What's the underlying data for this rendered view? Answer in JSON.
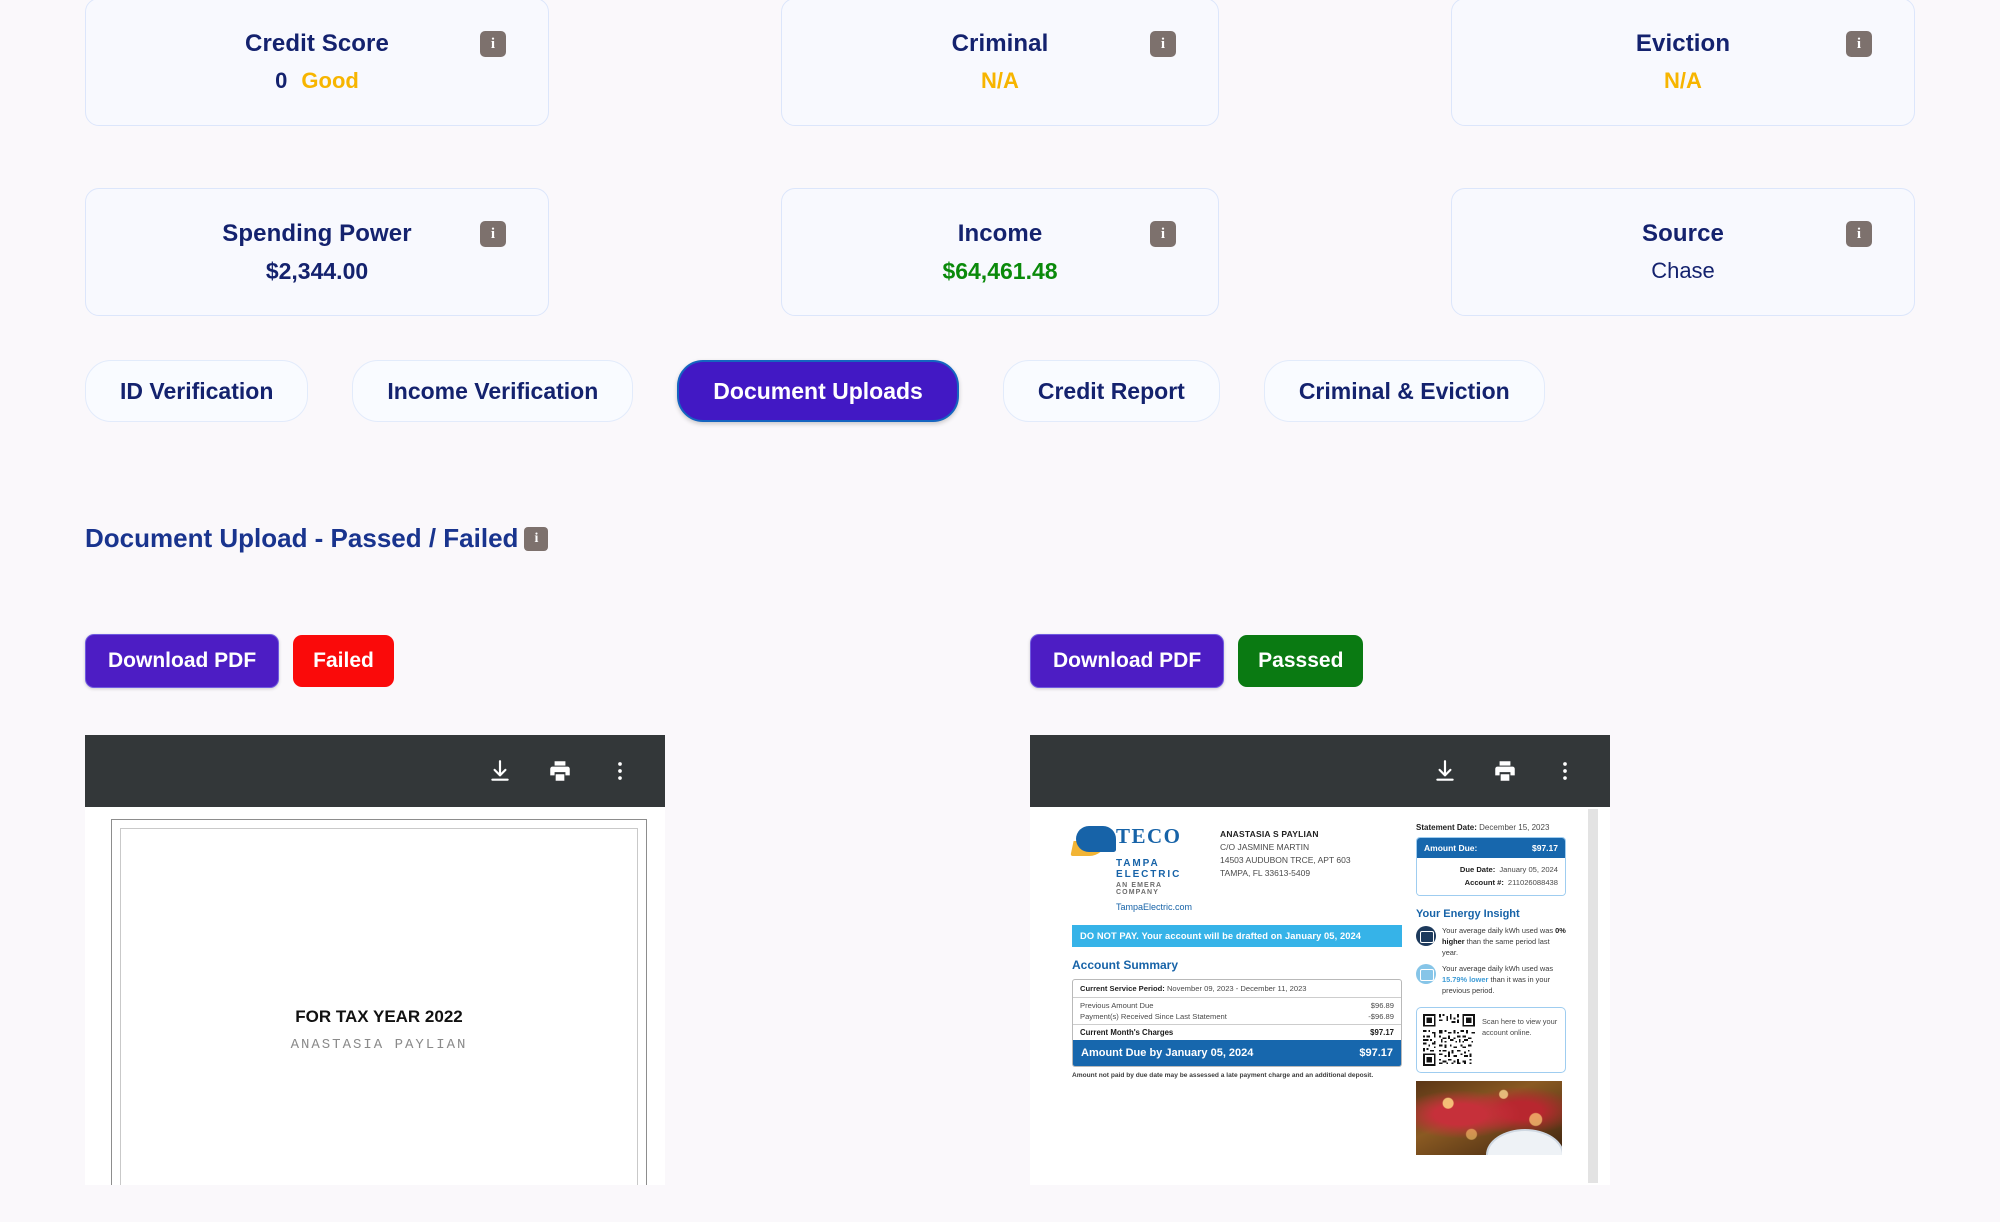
{
  "kpi_cards": [
    {
      "title": "Credit Score",
      "value": "0",
      "status": "Good",
      "status_color": "#f7b500",
      "info": "i"
    },
    {
      "title": "Criminal",
      "value": "",
      "status": "N/A",
      "status_color": "#f7b500",
      "info": "i"
    },
    {
      "title": "Eviction",
      "value": "",
      "status": "N/A",
      "status_color": "#f7b500",
      "info": "i"
    },
    {
      "title": "Spending Power",
      "value": "$2,344.00",
      "status": "",
      "status_color": "#14226e",
      "info": "i"
    },
    {
      "title": "Income",
      "value": "",
      "status": "$64,461.48",
      "status_color": "#0a8a0a",
      "info": "i"
    },
    {
      "title": "Source",
      "value": "",
      "status": "Chase",
      "status_color": "#14226e",
      "info": "i"
    }
  ],
  "tabs": [
    {
      "label": "ID Verification",
      "active": false
    },
    {
      "label": "Income Verification",
      "active": false
    },
    {
      "label": "Document Uploads",
      "active": true
    },
    {
      "label": "Credit Report",
      "active": false
    },
    {
      "label": "Criminal & Eviction",
      "active": false
    }
  ],
  "section": {
    "heading": "Document Upload - Passed / Failed",
    "info": "i"
  },
  "documents": [
    {
      "download_label": "Download PDF",
      "status_label": "Failed",
      "status_color": "#fa0a0a",
      "toolbar": {
        "download_icon": "download-icon",
        "print_icon": "print-icon",
        "more_icon": "more-vertical-icon"
      },
      "preview": {
        "kind": "tax-form",
        "title": "FOR TAX YEAR 2022",
        "subtitle": "ANASTASIA PAYLIAN"
      }
    },
    {
      "download_label": "Download PDF",
      "status_label": "Passsed",
      "status_color": "#0a7a12",
      "toolbar": {
        "download_icon": "download-icon",
        "print_icon": "print-icon",
        "more_icon": "more-vertical-icon"
      },
      "preview": {
        "kind": "utility-bill",
        "logo": {
          "name": "TECO",
          "line2": "TAMPA ELECTRIC",
          "line3": "AN EMERA COMPANY",
          "url": "TampaElectric.com"
        },
        "customer": {
          "name": "ANASTASIA S PAYLIAN",
          "line1": "C/O JASMINE MARTIN",
          "line2": "14503 AUDUBON TRCE, APT 603",
          "line3": "TAMPA, FL 33613-5409"
        },
        "notice": "DO NOT PAY. Your account will be drafted on January 05, 2024",
        "account_summary": {
          "heading": "Account Summary",
          "period_label": "Current Service Period:",
          "period_value": "November 09, 2023 - December 11, 2023",
          "rows": [
            {
              "label": "Previous Amount Due",
              "value": "$96.89"
            },
            {
              "label": "Payment(s) Received Since Last Statement",
              "value": "-$96.89"
            }
          ],
          "total_label": "Current Month's Charges",
          "total_value": "$97.17",
          "due_label": "Amount Due by January 05, 2024",
          "due_value": "$97.17",
          "note": "Amount not paid by due date may be assessed a late payment charge and an additional deposit."
        },
        "statement": {
          "date_label": "Statement Date:",
          "date_value": "December 15, 2023",
          "amount_due_label": "Amount Due:",
          "amount_due_value": "$97.17",
          "due_date_label": "Due Date:",
          "due_date_value": "January 05, 2024",
          "account_label": "Account #:",
          "account_value": "211026088438"
        },
        "energy_insight": {
          "heading": "Your Energy Insight",
          "items": [
            {
              "pre": "Your average daily kWh used was ",
              "em": "0% higher",
              "post": " than the same period last year.",
              "em_style": "bold"
            },
            {
              "pre": "Your average daily kWh used was ",
              "em": "15.79% lower",
              "post": " than it was in your previous period.",
              "em_style": "lower"
            }
          ]
        },
        "qr": {
          "text": "Scan here to view your account online."
        }
      }
    }
  ]
}
